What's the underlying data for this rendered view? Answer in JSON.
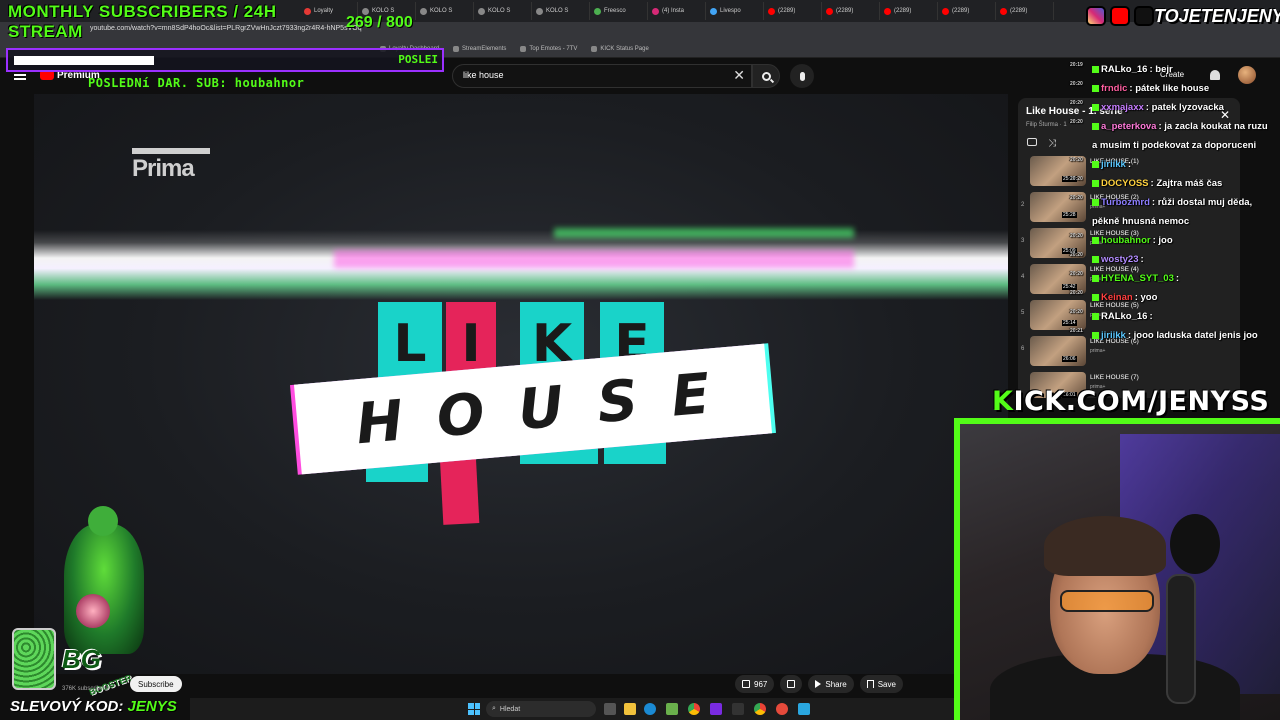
{
  "overlay": {
    "monthly_title": "MONTHLY SUBSCRIBERS / 24H STREAM",
    "sub_count": "269",
    "sub_goal": "/ 800",
    "ticker_text": "POSLEDNí DAR. SUB: houbahnor",
    "ticker_right": "POSLEI",
    "social_handle": "TOJETENJENYS",
    "kick_prefix": "K",
    "kick_rest": "ICK.COM/JENYSS",
    "promo_label": "SLEVOVÝ KOD:",
    "promo_code": "JENYS",
    "booster_tag": "BG",
    "booster_sub": "BOOSTER"
  },
  "browser": {
    "url": "youtube.com/watch?v=mn8SdP4hoOc&list=PLRgrZVwHnJczt7933ng2r4R4-hNP5sVOq",
    "tabs": [
      "Loyalty",
      "KOLO S",
      "KOLO S",
      "KOLO S",
      "KOLO S",
      "Freesco",
      "(4) Insta",
      "Livespo",
      "(2289)",
      "(2289)",
      "(2289)",
      "(2289)",
      "(2289)"
    ],
    "bookmarks": [
      "Loyalty Dashboard",
      "StreamElements",
      "Top Emotes - 7TV",
      "KICK Status Page"
    ]
  },
  "youtube": {
    "premium_label": "Premium",
    "search_value": "like house",
    "create_label": "Create",
    "notif_count": "9+",
    "channel_subs": "376K subscribers",
    "subscribe_label": "Subscribe",
    "like_count": "967",
    "share_label": "Share",
    "save_label": "Save"
  },
  "video": {
    "channel_logo": "Prima",
    "like_letters": [
      "L",
      "I",
      "K",
      "E"
    ],
    "house_text": "HOUSE"
  },
  "playlist": {
    "title": "Like House - 1. série",
    "author": "Filip Šturma · 1",
    "items": [
      {
        "num": "",
        "name": "LIKE HOUSE (1)",
        "sub": "",
        "dur": "25:37"
      },
      {
        "num": "2",
        "name": "LIKE HOUSE (2)",
        "sub": "prima+",
        "dur": "25:28"
      },
      {
        "num": "3",
        "name": "LIKE HOUSE (3)",
        "sub": "prima+",
        "dur": "25:09"
      },
      {
        "num": "4",
        "name": "LIKE HOUSE (4)",
        "sub": "prima+",
        "dur": "25:42"
      },
      {
        "num": "5",
        "name": "LIKE HOUSE (5)",
        "sub": "prima+",
        "dur": "25:14"
      },
      {
        "num": "6",
        "name": "LIKE HOUSE (6)",
        "sub": "prima+",
        "dur": "26:06"
      },
      {
        "num": "",
        "name": "LIKE HOUSE (7)",
        "sub": "prima+",
        "dur": "26:01"
      }
    ]
  },
  "chat": [
    {
      "time": "20:19",
      "user": "RALko_16",
      "color": "#ffffff",
      "text": ": bejr"
    },
    {
      "time": "20:20",
      "user": "frndic",
      "color": "#ff5fa0",
      "text": ": pátek like house"
    },
    {
      "time": "20:20",
      "user": "xxmajaxx",
      "color": "#c77dff",
      "text": ": patek lyzovacka"
    },
    {
      "time": "20:20",
      "user": "a_peterkova",
      "color": "#ff7ad9",
      "text": ": ja zacla koukat na ruzu a musim ti podekovat za doporuceni"
    },
    {
      "time": "20:20",
      "user": "jiriikk",
      "color": "#5ac8ff",
      "text": ":"
    },
    {
      "time": "20:20",
      "user": "DOCYOSS",
      "color": "#ffd23f",
      "text": ": Zajtra máš čas"
    },
    {
      "time": "20:20",
      "user": "Turbozmrd",
      "color": "#8c7dff",
      "text": ": růži dostal muj děda, pěkně hnusná nemoc"
    },
    {
      "time": "20:20",
      "user": "houbahnor",
      "color": "#53fc18",
      "text": ": joo"
    },
    {
      "time": "20:20",
      "user": "wosty23",
      "color": "#b38cff",
      "text": ":"
    },
    {
      "time": "20:20",
      "user": "HYENA_SYT_03",
      "color": "#53fc18",
      "text": ":"
    },
    {
      "time": "20:20",
      "user": "Keinan",
      "color": "#ff4040",
      "text": ": yoo"
    },
    {
      "time": "20:20",
      "user": "RALko_16",
      "color": "#ffffff",
      "text": ":"
    },
    {
      "time": "20:21",
      "user": "jiriikk",
      "color": "#5ac8ff",
      "text": ": jooo laduska datel jenis joo"
    }
  ],
  "taskbar": {
    "search_placeholder": "Hledat"
  },
  "colors": {
    "accent_green": "#53fc18",
    "purple_frame": "#9b30ff",
    "like_teal": "#19d3c9",
    "like_pink": "#e5245a",
    "youtube_red": "#ff0000"
  },
  "icons": [
    "instagram-icon",
    "youtube-icon",
    "tiktok-icon",
    "search-icon",
    "mic-icon",
    "clear-icon",
    "bell-icon",
    "thumb-up-icon",
    "thumb-down-icon",
    "share-icon",
    "save-icon",
    "windows-icon"
  ]
}
